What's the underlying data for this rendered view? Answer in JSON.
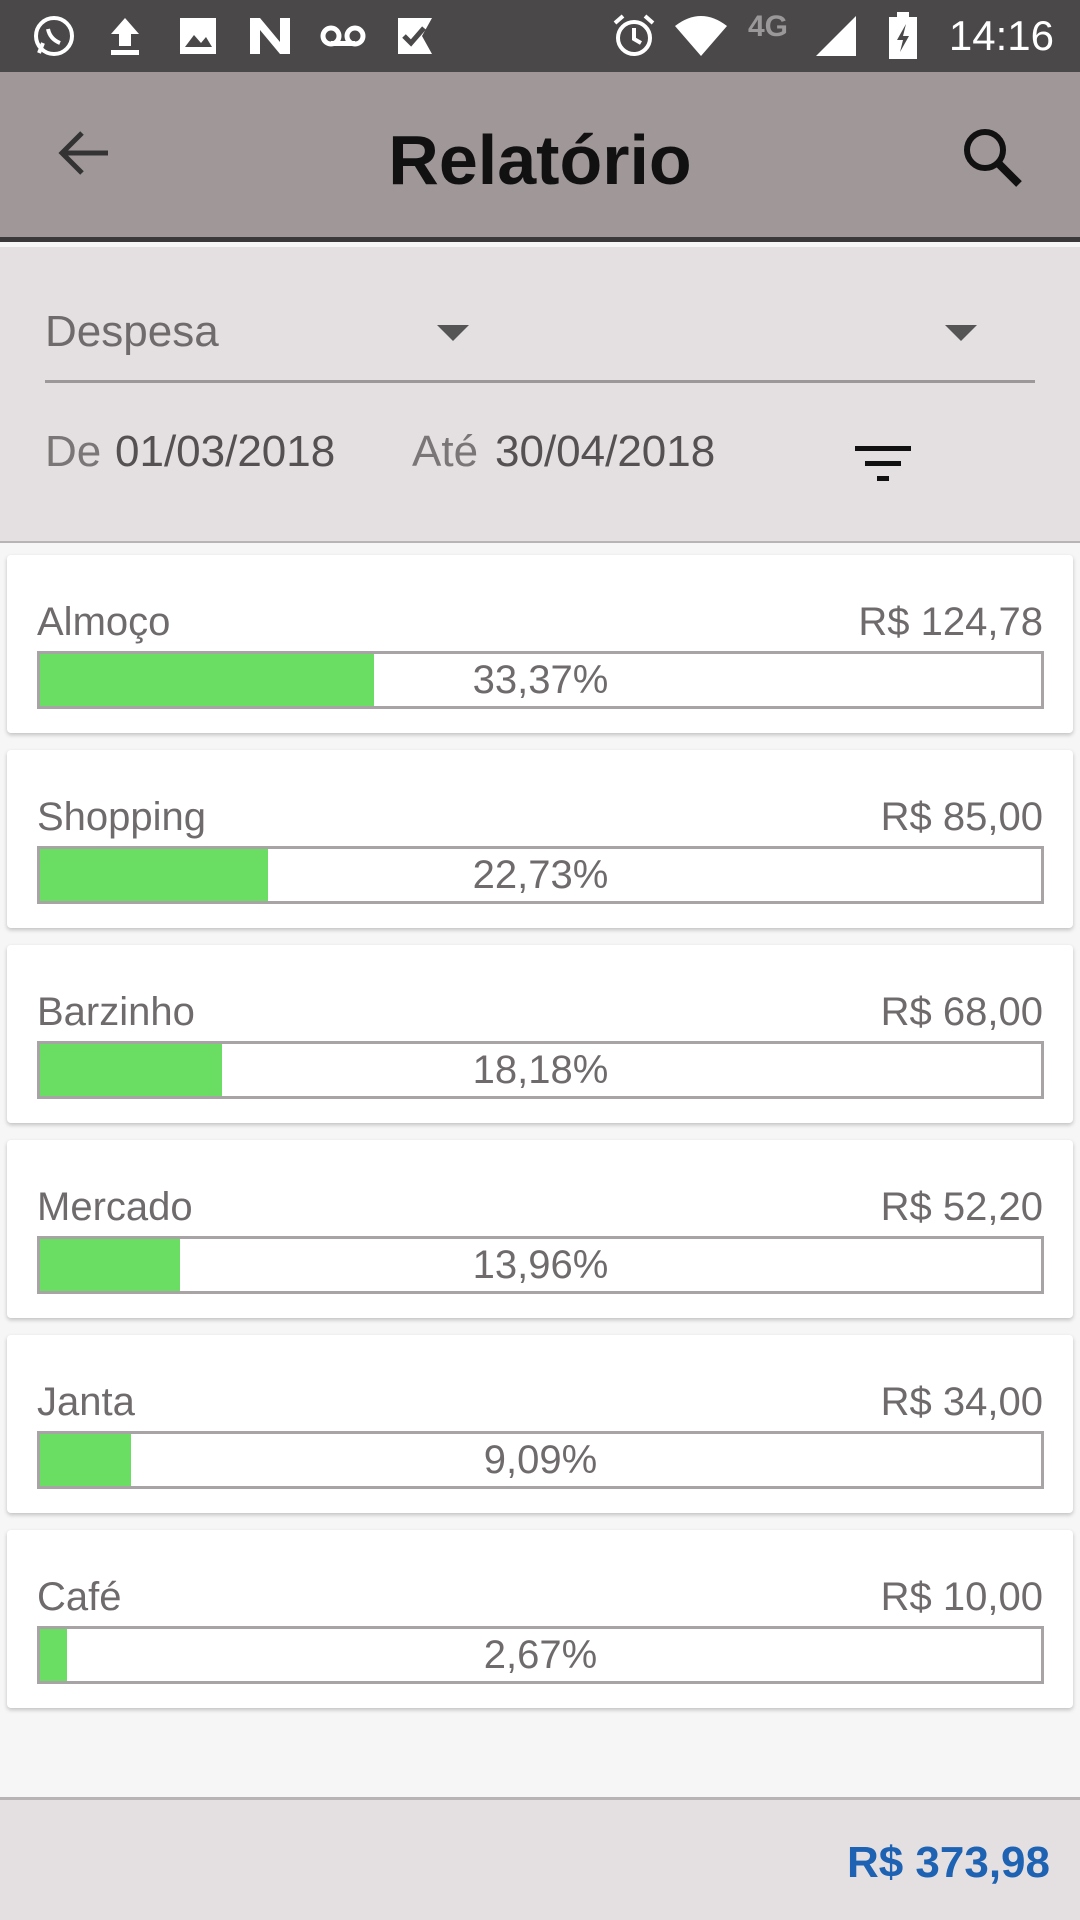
{
  "status_bar": {
    "time": "14:16",
    "network": "4G",
    "icons": [
      "whatsapp-icon",
      "upload-icon",
      "image-icon",
      "n-icon",
      "voicemail-icon",
      "check-icon",
      "alarm-icon",
      "wifi-icon",
      "signal-icon",
      "battery-icon"
    ]
  },
  "app_bar": {
    "title": "Relatório",
    "back_icon": "arrow-left-icon",
    "search_icon": "search-icon"
  },
  "filters": {
    "type_selected": "Despesa",
    "category_selected": "",
    "from_label": "De",
    "from_date": "01/03/2018",
    "to_label": "Até",
    "to_date": "30/04/2018",
    "filter_icon": "filter-list-icon"
  },
  "categories": [
    {
      "name": "Almoço",
      "value": "R$ 124,78",
      "percent_label": "33,37%",
      "fraction": 0.3337
    },
    {
      "name": "Shopping",
      "value": "R$ 85,00",
      "percent_label": "22,73%",
      "fraction": 0.2273
    },
    {
      "name": "Barzinho",
      "value": "R$ 68,00",
      "percent_label": "18,18%",
      "fraction": 0.1818
    },
    {
      "name": "Mercado",
      "value": "R$ 52,20",
      "percent_label": "13,96%",
      "fraction": 0.1396
    },
    {
      "name": "Janta",
      "value": "R$ 34,00",
      "percent_label": "9,09%",
      "fraction": 0.0909
    },
    {
      "name": "Café",
      "value": "R$ 10,00",
      "percent_label": "2,67%",
      "fraction": 0.0267
    }
  ],
  "footer": {
    "total": "R$ 373,98"
  },
  "colors": {
    "status_bar": "#4a4849",
    "app_bar": "#a09799",
    "bar_fill": "#6ade63",
    "total_text": "#1e62b3"
  }
}
